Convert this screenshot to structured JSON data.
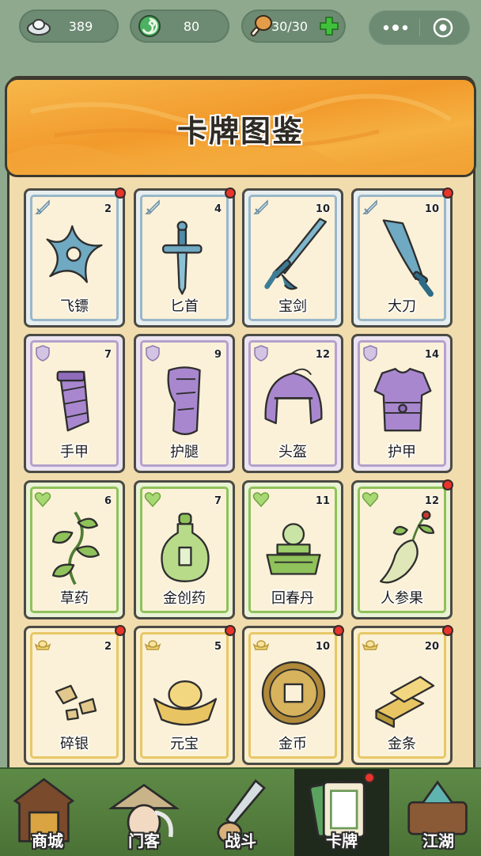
{
  "resources": {
    "silver": {
      "value": "389",
      "icon": "silver-ingot-icon"
    },
    "jade": {
      "value": "80",
      "icon": "jade-swirl-icon"
    },
    "food": {
      "value": "30/30",
      "icon": "drumstick-icon"
    }
  },
  "title": "卡牌图鉴",
  "cards": [
    {
      "name": "飞镖",
      "count": "2",
      "rarity": "blue",
      "badge": "sword-badge-icon",
      "art": "shuriken-icon",
      "new": true
    },
    {
      "name": "匕首",
      "count": "4",
      "rarity": "blue",
      "badge": "sword-badge-icon",
      "art": "dagger-icon",
      "new": true
    },
    {
      "name": "宝剑",
      "count": "10",
      "rarity": "blue",
      "badge": "sword-badge-icon",
      "art": "sword-icon",
      "new": false
    },
    {
      "name": "大刀",
      "count": "10",
      "rarity": "blue",
      "badge": "sword-badge-icon",
      "art": "broadsword-icon",
      "new": true
    },
    {
      "name": "手甲",
      "count": "7",
      "rarity": "purple",
      "badge": "shield-badge-icon",
      "art": "bracer-icon",
      "new": false
    },
    {
      "name": "护腿",
      "count": "9",
      "rarity": "purple",
      "badge": "shield-badge-icon",
      "art": "greave-icon",
      "new": false
    },
    {
      "name": "头盔",
      "count": "12",
      "rarity": "purple",
      "badge": "shield-badge-icon",
      "art": "helmet-icon",
      "new": false
    },
    {
      "name": "护甲",
      "count": "14",
      "rarity": "purple",
      "badge": "shield-badge-icon",
      "art": "armor-icon",
      "new": false
    },
    {
      "name": "草药",
      "count": "6",
      "rarity": "green",
      "badge": "heart-badge-icon",
      "art": "herb-icon",
      "new": false
    },
    {
      "name": "金创药",
      "count": "7",
      "rarity": "green",
      "badge": "heart-badge-icon",
      "art": "potion-icon",
      "new": false
    },
    {
      "name": "回春丹",
      "count": "11",
      "rarity": "green",
      "badge": "heart-badge-icon",
      "art": "pill-icon",
      "new": false
    },
    {
      "name": "人参果",
      "count": "12",
      "rarity": "green",
      "badge": "heart-badge-icon",
      "art": "ginseng-icon",
      "new": true
    },
    {
      "name": "碎银",
      "count": "2",
      "rarity": "gold",
      "badge": "ingot-badge-icon",
      "art": "silver-pieces-icon",
      "new": true
    },
    {
      "name": "元宝",
      "count": "5",
      "rarity": "gold",
      "badge": "ingot-badge-icon",
      "art": "yuanbao-icon",
      "new": true
    },
    {
      "name": "金币",
      "count": "10",
      "rarity": "gold",
      "badge": "ingot-badge-icon",
      "art": "gold-coin-icon",
      "new": true
    },
    {
      "name": "金条",
      "count": "20",
      "rarity": "gold",
      "badge": "ingot-badge-icon",
      "art": "gold-bar-icon",
      "new": true
    }
  ],
  "nav": [
    {
      "label": "商城",
      "icon": "shop-icon",
      "active": false
    },
    {
      "label": "门客",
      "icon": "retainer-icon",
      "active": false
    },
    {
      "label": "战斗",
      "icon": "battle-icon",
      "active": false
    },
    {
      "label": "卡牌",
      "icon": "card-icon",
      "active": true,
      "new": true
    },
    {
      "label": "江湖",
      "icon": "jianghu-icon",
      "active": false
    }
  ],
  "colors": {
    "accent": "#f29a2c",
    "blue": "#9ab7c8",
    "purple": "#b4a1cc",
    "green": "#8fc25a",
    "gold": "#e7c766",
    "notice": "#e8342a"
  }
}
